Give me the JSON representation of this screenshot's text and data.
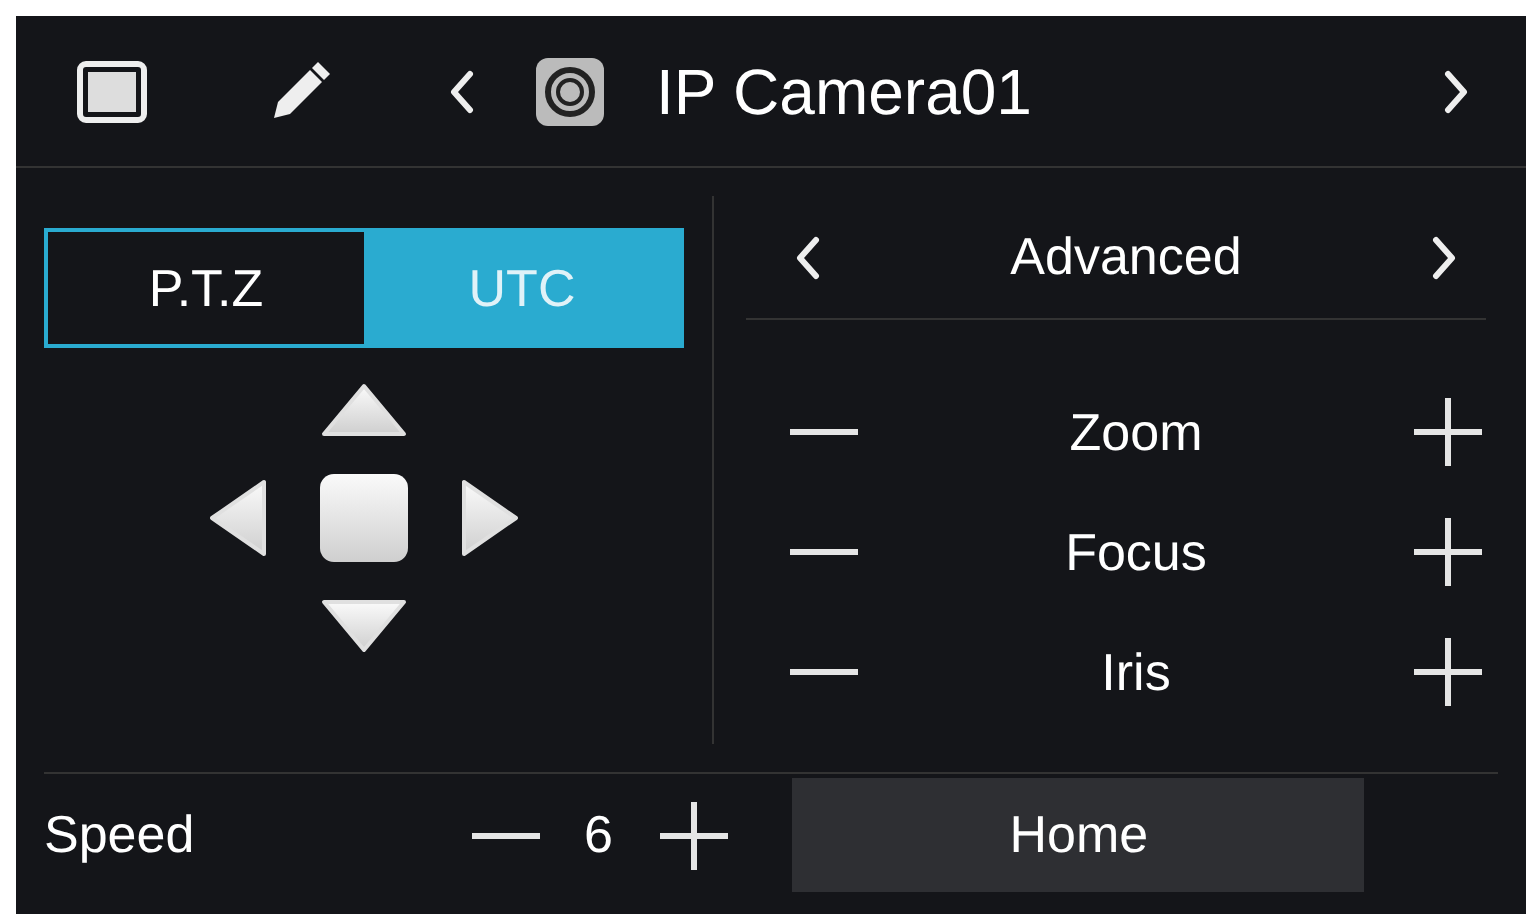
{
  "header": {
    "title": "IP Camera01"
  },
  "tabs": [
    {
      "label": "P.T.Z",
      "selected": false
    },
    {
      "label": "UTC",
      "selected": true
    }
  ],
  "advanced": {
    "title": "Advanced"
  },
  "adjustments": [
    {
      "label": "Zoom"
    },
    {
      "label": "Focus"
    },
    {
      "label": "Iris"
    }
  ],
  "speed": {
    "label": "Speed",
    "value": "6"
  },
  "home_button": "Home"
}
